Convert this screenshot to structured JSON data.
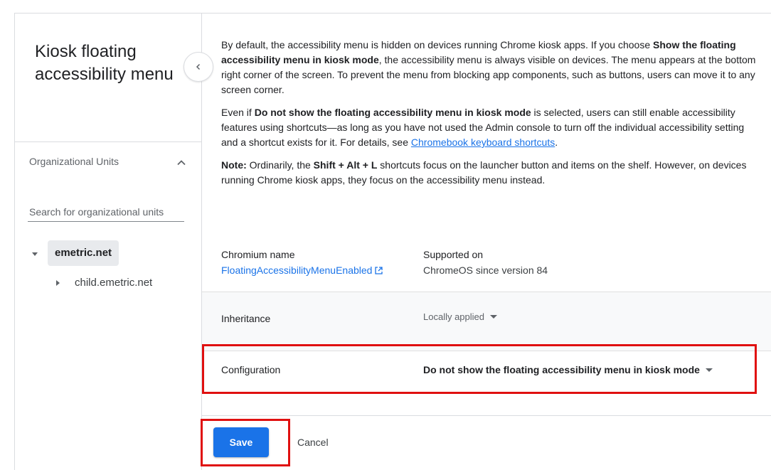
{
  "panel": {
    "title": "Kiosk floating accessibility menu",
    "collapse_icon": "chevron-left-icon"
  },
  "org_units": {
    "header": "Organizational Units",
    "header_icon": "chevron-up-icon",
    "search_placeholder": "Search for organizational units",
    "tree": [
      {
        "label": "emetric.net",
        "expanded": true,
        "selected": true
      },
      {
        "label": "child.emetric.net",
        "expanded": false,
        "selected": false
      }
    ]
  },
  "description": {
    "p1": {
      "a": "By default, the accessibility menu is hidden on devices running Chrome kiosk apps. If you choose ",
      "b": "Show the floating accessibility menu in kiosk mode",
      "c": ", the accessibility menu is always visible on devices. The menu appears at the bottom right corner of the screen. To prevent the menu from blocking app components, such as buttons, users can move it to any screen corner."
    },
    "p2": {
      "a": "Even if ",
      "b": "Do not show the floating accessibility menu in kiosk mode",
      "c": " is selected, users can still enable accessibility features using shortcuts—as long as you have not used the Admin console to turn off the individual accessibility setting and a shortcut exists for it. For details, see ",
      "link": "Chromebook keyboard shortcuts",
      "d": "."
    },
    "p3": {
      "note": "Note:",
      "a": " Ordinarily, the ",
      "b": "Shift + Alt + L",
      "c": " shortcuts focus on the launcher button and items on the shelf. However, on devices running Chrome kiosk apps, they focus on the accessibility menu instead."
    }
  },
  "meta": {
    "chromium_label": "Chromium name",
    "chromium_value": "FloatingAccessibilityMenuEnabled",
    "chromium_icon": "external-link-icon",
    "supported_label": "Supported on",
    "supported_value": "ChromeOS since version 84"
  },
  "inheritance": {
    "label": "Inheritance",
    "value": "Locally applied"
  },
  "configuration": {
    "label": "Configuration",
    "value": "Do not show the floating accessibility menu in kiosk mode"
  },
  "actions": {
    "save": "Save",
    "cancel": "Cancel"
  },
  "colors": {
    "accent": "#1a73e8",
    "highlight": "#e01010",
    "band": "#f8f9fa"
  }
}
